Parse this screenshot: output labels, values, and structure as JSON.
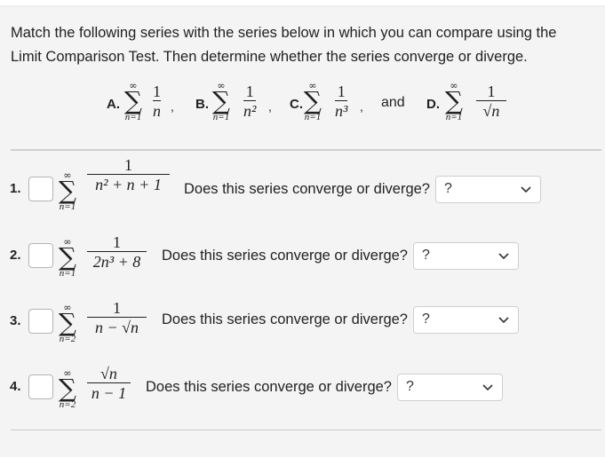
{
  "prompt": "Match the following series with the series below in which you can compare using the Limit Comparison Test. Then determine whether the series converge or diverge.",
  "options": [
    {
      "label": "A.",
      "upper": "∞",
      "lower": "n=1",
      "numerator": "1",
      "denominator": "n",
      "sep": ","
    },
    {
      "label": "B.",
      "upper": "∞",
      "lower": "n=1",
      "numerator": "1",
      "denominator": "n²",
      "sep": ","
    },
    {
      "label": "C.",
      "upper": "∞",
      "lower": "n=1",
      "numerator": "1",
      "denominator": "n³",
      "sep": ","
    },
    {
      "label": "D.",
      "upper": "∞",
      "lower": "n=1",
      "numerator": "1",
      "denominator": "√n",
      "sep": ""
    }
  ],
  "and_text": "and",
  "questions": [
    {
      "index": "1.",
      "upper": "∞",
      "lower": "n=1",
      "numerator": "1",
      "denominator": "n² + n + 1",
      "question": "Does this series converge or diverge?",
      "selected": "?"
    },
    {
      "index": "2.",
      "upper": "∞",
      "lower": "n=1",
      "numerator": "1",
      "denominator": "2n³ + 8",
      "question": "Does this series converge or diverge?",
      "selected": "?"
    },
    {
      "index": "3.",
      "upper": "∞",
      "lower": "n=2",
      "numerator": "1",
      "denominator": "n − √n",
      "question": "Does this series converge or diverge?",
      "selected": "?"
    },
    {
      "index": "4.",
      "upper": "∞",
      "lower": "n=2",
      "numerator": "√n",
      "denominator": "n − 1",
      "question": "Does this series converge or diverge?",
      "selected": "?"
    }
  ],
  "icons": {
    "dropdown": "chevron-down-icon"
  }
}
